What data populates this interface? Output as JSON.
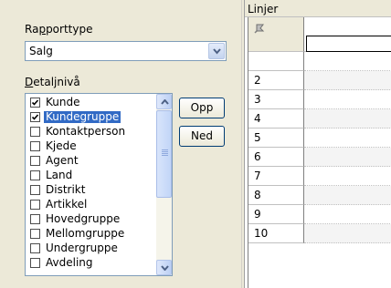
{
  "left_panel": {
    "rapporttype": {
      "label_prefix": "Ra",
      "label_underlined": "p",
      "label_suffix": "porttype",
      "selected_value": "Salg"
    },
    "detaljniva": {
      "label_underlined": "D",
      "label_suffix": "etaljnivå",
      "items": [
        {
          "label": "Kunde",
          "checked": true,
          "selected": false
        },
        {
          "label": "Kundegruppe",
          "checked": true,
          "selected": true
        },
        {
          "label": "Kontaktperson",
          "checked": false,
          "selected": false
        },
        {
          "label": "Kjede",
          "checked": false,
          "selected": false
        },
        {
          "label": "Agent",
          "checked": false,
          "selected": false
        },
        {
          "label": "Land",
          "checked": false,
          "selected": false
        },
        {
          "label": "Distrikt",
          "checked": false,
          "selected": false
        },
        {
          "label": "Artikkel",
          "checked": false,
          "selected": false
        },
        {
          "label": "Hovedgruppe",
          "checked": false,
          "selected": false
        },
        {
          "label": "Mellomgruppe",
          "checked": false,
          "selected": false
        },
        {
          "label": "Undergruppe",
          "checked": false,
          "selected": false
        },
        {
          "label": "Avdeling",
          "checked": false,
          "selected": false
        }
      ]
    },
    "buttons": {
      "up": "Opp",
      "down": "Ned"
    }
  },
  "right_panel": {
    "title": "Linjer",
    "rows": [
      "",
      "2",
      "3",
      "4",
      "5",
      "6",
      "7",
      "8",
      "9",
      "10"
    ]
  },
  "colors": {
    "panel_bg": "#ece9d8",
    "selection": "#316ac5",
    "input_border": "#7f9db9"
  }
}
